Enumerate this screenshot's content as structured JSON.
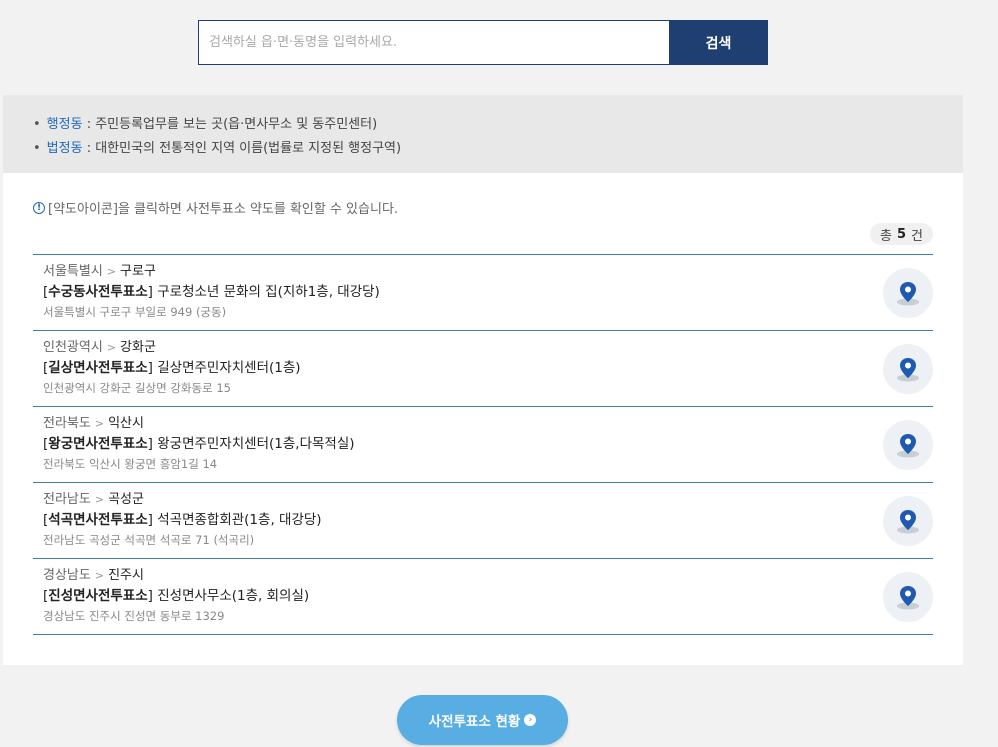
{
  "search": {
    "placeholder": "검색하실 읍·면·동명을 입력하세요.",
    "button_label": "검색"
  },
  "info": {
    "bullet": "•",
    "lines": [
      {
        "term": "행정동",
        "desc": " : 주민등록업무를 보는 곳(읍·면사무소 및 동주민센터)"
      },
      {
        "term": "법정동",
        "desc": " : 대한민국의 전통적인 지역 이름(법률로 지정된 행정구역)"
      }
    ]
  },
  "notice": {
    "icon": "!",
    "text": "[약도아이콘]을 클릭하면 사전투표소 약도를 확인할 수 있습니다."
  },
  "total": {
    "prefix": "총",
    "count": "5",
    "suffix": "건"
  },
  "results": [
    {
      "province": "서울특별시",
      "sep": ">",
      "city": "구로구",
      "lb": "[",
      "name": "수궁동사전투표소",
      "rb": "]",
      "venue": " 구로청소년 문화의 집(지하1층, 대강당)",
      "address": "서울특별시 구로구 부일로 949 (궁동)"
    },
    {
      "province": "인천광역시",
      "sep": ">",
      "city": "강화군",
      "lb": "[",
      "name": "길상면사전투표소",
      "rb": "]",
      "venue": " 길상면주민자치센터(1층)",
      "address": "인천광역시 강화군 길상면 강화동로 15"
    },
    {
      "province": "전라북도",
      "sep": ">",
      "city": "익산시",
      "lb": "[",
      "name": "왕궁면사전투표소",
      "rb": "]",
      "venue": " 왕궁면주민자치센터(1층,다목적실)",
      "address": "전라북도 익산시 왕궁면 흥암1길 14"
    },
    {
      "province": "전라남도",
      "sep": ">",
      "city": "곡성군",
      "lb": "[",
      "name": "석곡면사전투표소",
      "rb": "]",
      "venue": " 석곡면종합회관(1층, 대강당)",
      "address": "전라남도 곡성군 석곡면 석곡로 71 (석곡리)"
    },
    {
      "province": "경상남도",
      "sep": ">",
      "city": "진주시",
      "lb": "[",
      "name": "진성면사전투표소",
      "rb": "]",
      "venue": " 진성면사무소(1층, 회의실)",
      "address": "경상남도 진주시 진성면 동부로 1329"
    }
  ],
  "bottom_button": {
    "label": "사전투표소 현황",
    "arrow": "›"
  },
  "colors": {
    "primary": "#1f3f73",
    "accent": "#58aee3",
    "link": "#1e6ab8",
    "pin": "#1e5bb0"
  }
}
